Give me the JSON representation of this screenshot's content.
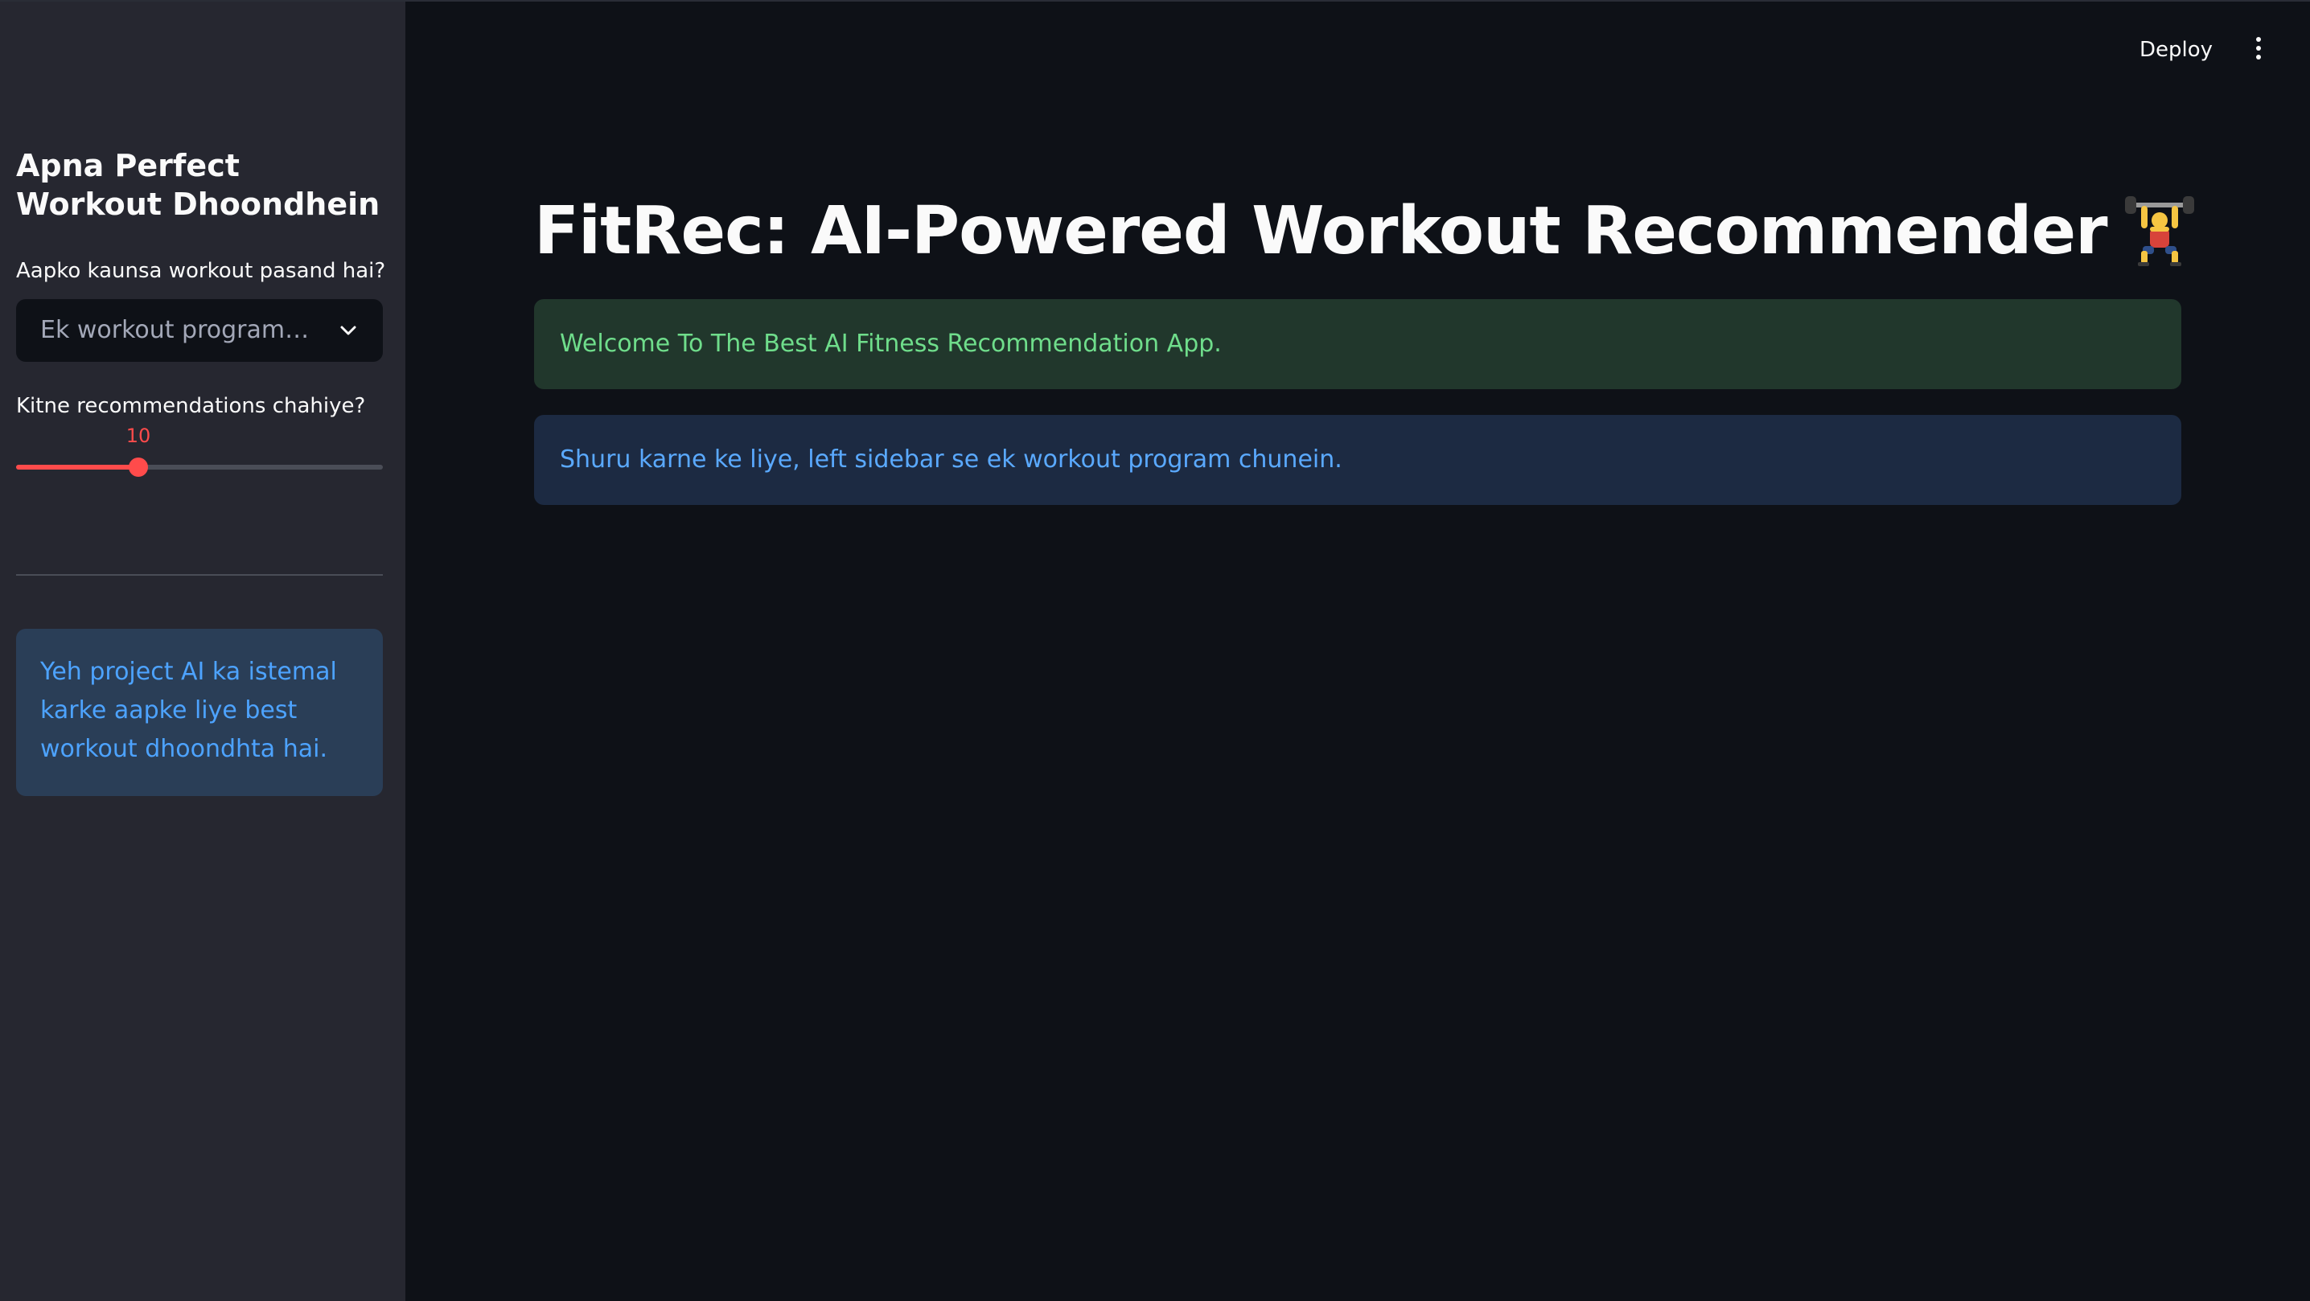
{
  "sidebar": {
    "title": "Apna Perfect Workout Dhoondhein",
    "workout_label": "Aapko kaunsa workout pasand hai?",
    "workout_select": {
      "value": "Ek workout program chunein"
    },
    "recs_label": "Kitne recommendations chahiye?",
    "recs_slider": {
      "value": "10",
      "fraction": 0.333
    },
    "info_text": "Yeh project AI ka istemal karke aapke liye best workout dhoondhta hai."
  },
  "header": {
    "deploy_label": "Deploy",
    "menu_icon": "vertical-dots-icon"
  },
  "main": {
    "title": "FitRec: AI-Powered Workout Recommender",
    "title_icon": "weightlifter-icon",
    "success_message": "Welcome To The Best AI Fitness Recommendation App.",
    "info_message": "Shuru karne ke liye, left sidebar se ek workout program chunein."
  },
  "colors": {
    "background": "#0e1117",
    "sidebar": "#262730",
    "accent": "#ff4b4b",
    "success_bg": "#21372c",
    "success_text": "#6fdd8b",
    "info_bg": "#1c2a42",
    "info_text": "#5aa9ff"
  }
}
